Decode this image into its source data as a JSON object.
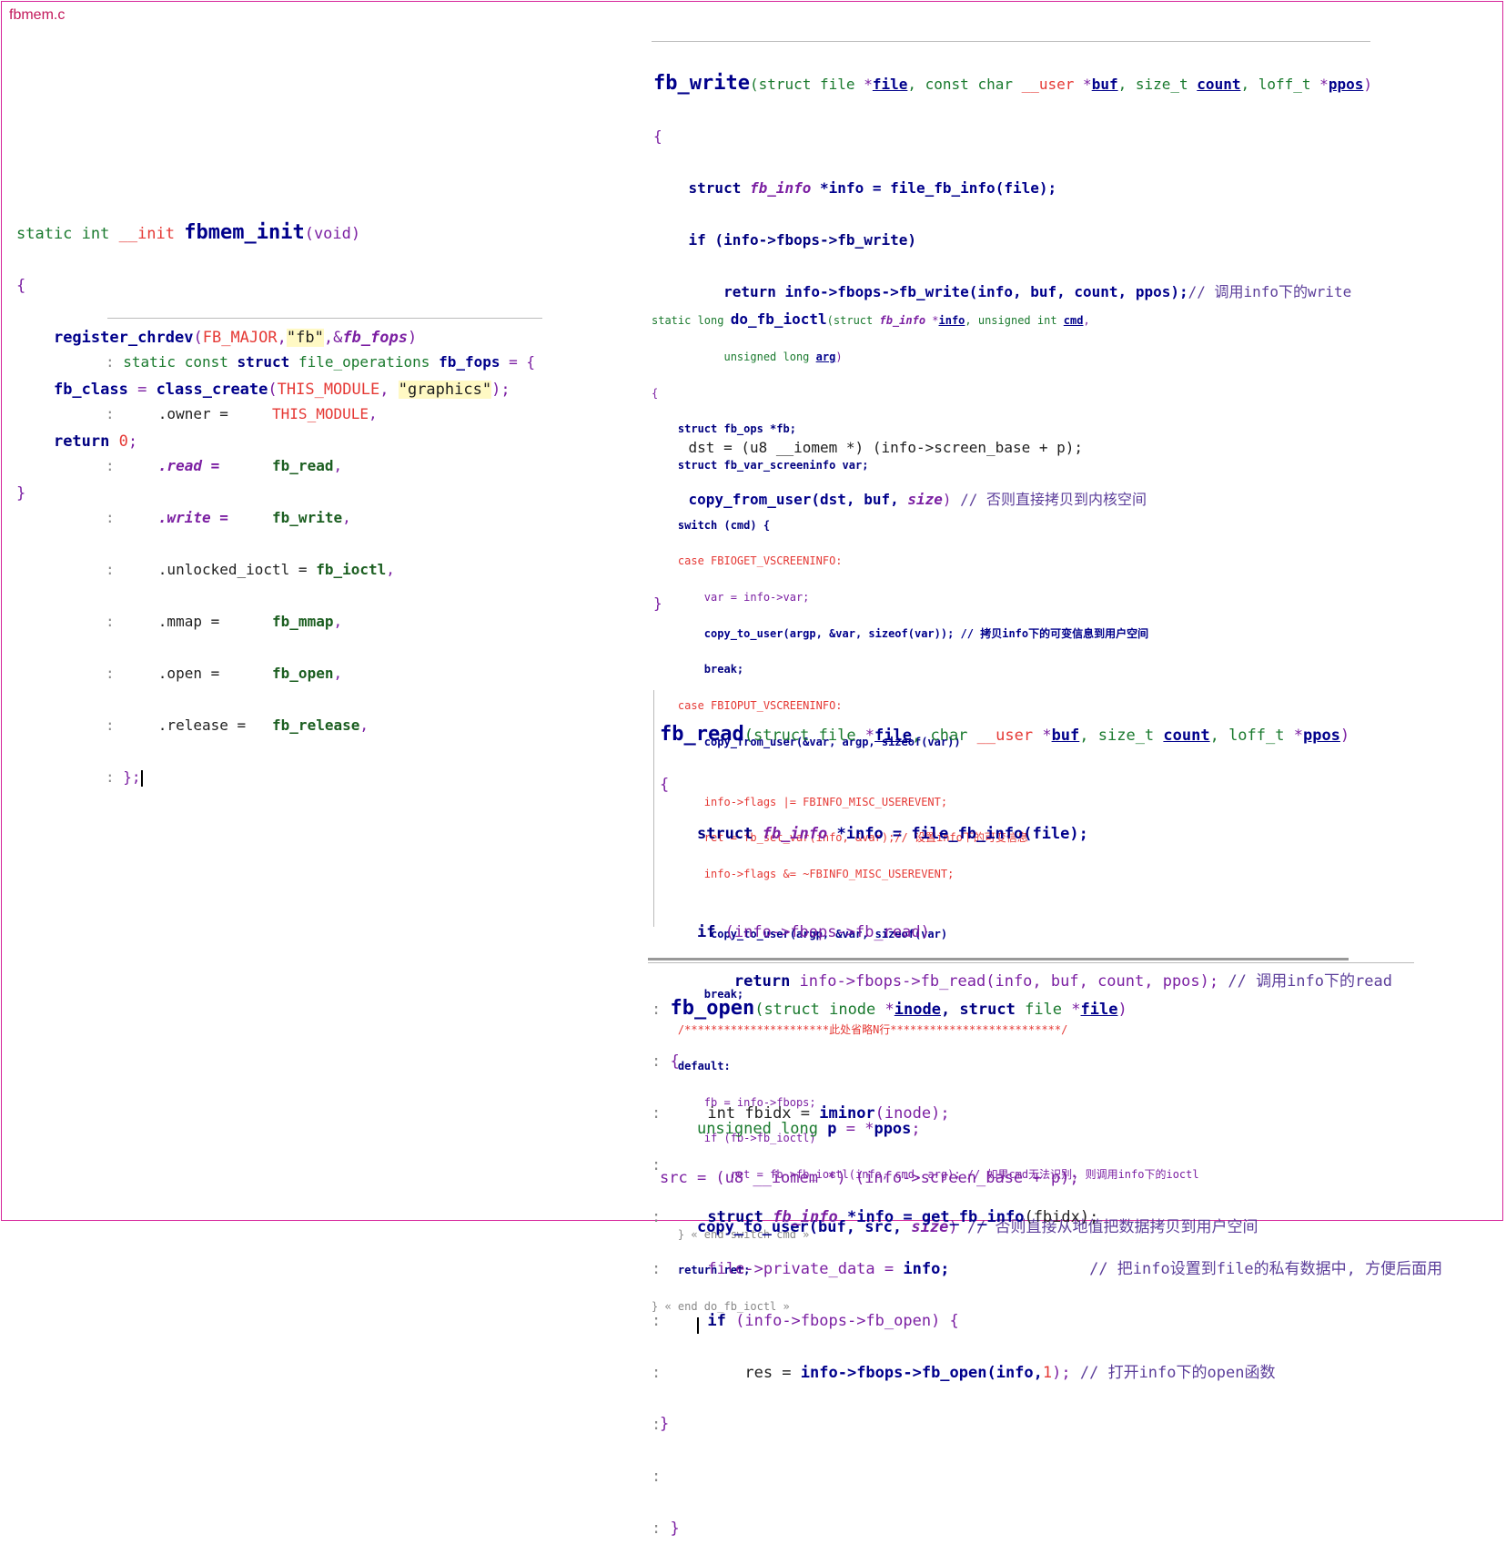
{
  "title": "fbmem.c",
  "fbmem_init": {
    "sig_static": "static int ",
    "sig_init": "__init ",
    "sig_name": "fbmem_init",
    "sig_args": "(void)",
    "open_brace": "{",
    "line1_fn": "register_chrdev",
    "line1_rest_a": "(",
    "line1_macro": "FB_MAJOR",
    "line1_comma": ",",
    "line1_str": "\"fb\"",
    "line1_amp": ",&",
    "line1_var": "fb_fops",
    "line1_close": ")",
    "line2_var": "fb_class",
    "line2_eq": " = ",
    "line2_fn": "class_create",
    "line2_paren": "(",
    "line2_macro": "THIS_MODULE",
    "line2_comma": ", ",
    "line2_str": "\"graphics\"",
    "line2_end": ");",
    "line3_ret": "return ",
    "line3_val": "0",
    "line3_semi": ";",
    "close_brace": "}"
  },
  "fb_fops": {
    "head_a": "static const ",
    "head_struct": "struct ",
    "head_type": "file_operations ",
    "head_name": "fb_fops",
    "head_end": " = {",
    "rows": [
      {
        "field": ".owner =     ",
        "value": "THIS_MODULE",
        "tail": ","
      },
      {
        "field": ".read =      ",
        "value": "fb_read",
        "tail": ","
      },
      {
        "field": ".write =     ",
        "value": "fb_write",
        "tail": ","
      },
      {
        "field": ".unlocked_ioctl = ",
        "value": "fb_ioctl",
        "tail": ","
      },
      {
        "field": ".mmap =      ",
        "value": "fb_mmap",
        "tail": ","
      },
      {
        "field": ".open =      ",
        "value": "fb_open",
        "tail": ","
      },
      {
        "field": ".release =   ",
        "value": "fb_release",
        "tail": ","
      }
    ],
    "close": "};"
  },
  "fb_write": {
    "name": "fb_write",
    "args_a": "(struct ",
    "args_file_t": "file ",
    "args_star1": "*",
    "args_file": "file",
    "args_b": ", const char ",
    "args_user": "__user ",
    "args_star2": "*",
    "args_buf": "buf",
    "args_c": ", size_t ",
    "args_count": "count",
    "args_d": ", loff_t ",
    "args_star3": "*",
    "args_ppos": "ppos",
    "args_e": ")",
    "open": "{",
    "l1_a": "struct ",
    "l1_type": "fb_info ",
    "l1_b": "*info = ",
    "l1_fn": "file_fb_info",
    "l1_c": "(file);",
    "l2": "if (info->fbops->fb_write)",
    "l3_a": "return ",
    "l3_b": "info->fbops->fb_write(info, buf, count, ppos);",
    "l3_cmt": "// 调用info下的write",
    "l4": "dst = (u8 __iomem *) (info->screen_base + p);",
    "l5_fn": "copy_from_user",
    "l5_rest": "(dst, buf, ",
    "l5_size": "size",
    "l5_end": ") ",
    "l5_cmt": "// 否则直接拷贝到内核空间",
    "close": "}"
  },
  "do_fb_ioctl": {
    "sig_a": "static long ",
    "sig_name": "do_fb_ioctl",
    "sig_b": "(struct ",
    "sig_type": "fb_info ",
    "sig_star": "*",
    "sig_info": "info",
    "sig_c": ", unsigned int ",
    "sig_cmd": "cmd",
    "sig_d": ",",
    "sig_line2_a": "unsigned long ",
    "sig_arg": "arg",
    "sig_line2_b": ")",
    "lines": [
      "{",
      "    struct fb_ops *fb;",
      "    struct fb_var_screeninfo var;",
      "",
      "    switch (cmd) {",
      "    case FBIOGET_VSCREENINFO:",
      "        var = info->var;",
      "        copy_to_user(argp, &var, sizeof(var)); // 拷贝info下的可变信息到用户空间",
      "        break;",
      "    case FBIOPUT_VSCREENINFO:",
      "        copy_from_user(&var, argp, sizeof(var))",
      "",
      "        info->flags |= FBINFO_MISC_USEREVENT;",
      "        ret = fb_set_var(info, &var);// 设置info下的可变信息",
      "        info->flags &= ~FBINFO_MISC_USEREVENT;",
      "",
      "         copy_to_user(argp, &var, sizeof(var)",
      "",
      "        break;",
      "    /**********************此处省略N行**************************/",
      "    default:",
      "        fb = info->fbops;",
      "        if (fb->fb_ioctl)",
      "            ret = fb->fb_ioctl(info, cmd, arg); // 如果cmd无法识别, 则调用info下的ioctl",
      "",
      "    } « end switch cmd »",
      "    return ret;",
      "} « end do_fb_ioctl »"
    ]
  },
  "fb_read": {
    "name": "fb_read",
    "args_a": "(struct ",
    "args_file_t": "file ",
    "args_star1": "*",
    "args_file": "file",
    "args_b": ", char ",
    "args_user": "__user ",
    "args_star2": "*",
    "args_buf": "buf",
    "args_c": ", size_t ",
    "args_count": "count",
    "args_d": ", loff_t ",
    "args_star3": "*",
    "args_ppos": "ppos",
    "args_e": ")",
    "open": "{",
    "l1_a": "struct ",
    "l1_type": "fb_info ",
    "l1_b": "*info = ",
    "l1_fn": "file_fb_info",
    "l1_c": "(file);",
    "l2_a": "if ",
    "l2_b": "(info->fbops->fb_read)",
    "l3_a": "return ",
    "l3_b": "info->fbops->fb_read(info, buf, count, ppos);",
    "l3_cmt": " // 调用info下的read",
    "l4_a": "unsigned long ",
    "l4_p": "p",
    "l4_b": " = *",
    "l4_ppos": "ppos",
    "l4_c": ";",
    "l5": "src = (u8 __iomem *) (info->screen_base + p);",
    "l6_fn": "copy_to_user",
    "l6_rest": "(buf, src, ",
    "l6_size": "size",
    "l6_end": ") ",
    "l6_cmt": "// 否则直接从地值把数据拷贝到用户空间",
    "close": "}"
  },
  "fb_open": {
    "name": "fb_open",
    "args_a": "(struct ",
    "args_inode_t": "inode ",
    "args_star1": "*",
    "args_inode": "inode",
    "args_b": ", struct ",
    "args_file_t": "file ",
    "args_star2": "*",
    "args_file": "file",
    "args_c": ")",
    "open": "{",
    "l1_a": "int fbidx = ",
    "l1_fn": "iminor",
    "l1_b": "(inode);",
    "l2_a": "struct ",
    "l2_type": "fb_info ",
    "l2_b": "*info = ",
    "l2_fn": "get_fb_info",
    "l2_c": "(fbidx);",
    "l3_a": "file->private_data = ",
    "l3_b": "info;",
    "l3_cmt": "// 把info设置到file的私有数据中, 方便后面用",
    "l4_a": "if ",
    "l4_b": "(info->fbops->fb_open) {",
    "l5_a": "res = ",
    "l5_b": "info->fbops->fb_open(info,",
    "l5_num": "1",
    "l5_c": "); ",
    "l5_cmt": "// 打开info下的open函数",
    "close": "}"
  }
}
